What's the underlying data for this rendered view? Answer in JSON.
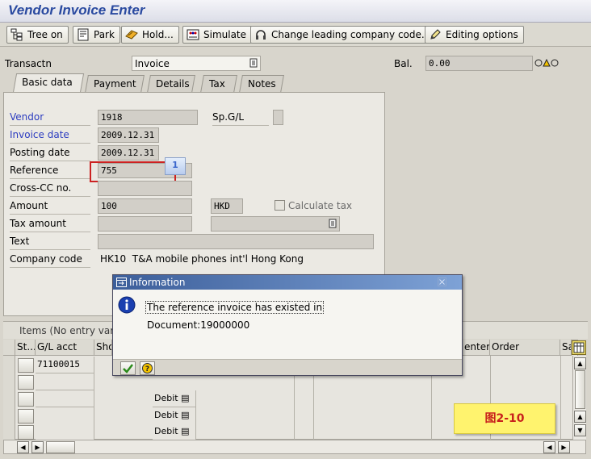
{
  "window": {
    "title": "Vendor Invoice Enter"
  },
  "toolbar": {
    "tree_label": "Tree on",
    "park_label": "Park",
    "hold_label": "Hold...",
    "simulate_label": "Simulate",
    "company_label": "Change leading company code...",
    "editing_label": "Editing options"
  },
  "header": {
    "transaction_label": "Transactn",
    "transaction_value": "Invoice",
    "balance_label": "Bal.",
    "balance_value": "0.00"
  },
  "tabs": [
    "Basic data",
    "Payment",
    "Details",
    "Tax",
    "Notes"
  ],
  "form": {
    "vendor_label": "Vendor",
    "vendor_value": "1918",
    "spgl_label": "Sp.G/L",
    "invoice_date_label": "Invoice date",
    "invoice_date_value": "2009.12.31",
    "posting_date_label": "Posting date",
    "posting_date_value": "2009.12.31",
    "reference_label": "Reference",
    "reference_value": "755",
    "reference_marker": "1",
    "crosscc_label": "Cross-CC no.",
    "amount_label": "Amount",
    "amount_value": "100",
    "currency_value": "HKD",
    "calc_tax_label": "Calculate tax",
    "tax_amount_label": "Tax amount",
    "text_label": "Text",
    "company_code_label": "Company code",
    "company_code_value": "HK10  T&A mobile phones int'l Hong Kong"
  },
  "items": {
    "title": "Items (No entry varia",
    "columns": [
      "St...",
      "G/L acct",
      "Sho",
      "enter",
      "Order",
      "Sa"
    ],
    "rows": [
      {
        "gl": "71100015",
        "dc": ""
      },
      {
        "gl": "",
        "dc": ""
      },
      {
        "gl": "",
        "dc": "Debit"
      },
      {
        "gl": "",
        "dc": "Debit"
      },
      {
        "gl": "",
        "dc": "Debit"
      }
    ]
  },
  "dialog": {
    "title": "Information",
    "message": "The reference invoice has existed in",
    "document": "Document:19000000"
  },
  "figure_label": "图2-10",
  "colors": {
    "title_blue": "#2a4aa0",
    "label_blue": "#2c3cc0",
    "reference_highlight": "#cc2222",
    "marker_blue": "#3a66cc",
    "figure_label_bg": "#fff36e",
    "figure_label_text": "#c8201c"
  },
  "icons": [
    "tree-icon",
    "park-icon",
    "hold-icon",
    "simulate-icon",
    "headset-icon",
    "pencil-icon",
    "dropdown-icon",
    "status-lights-icon",
    "info-icon",
    "check-icon",
    "help-icon",
    "close-icon",
    "table-settings-icon"
  ]
}
